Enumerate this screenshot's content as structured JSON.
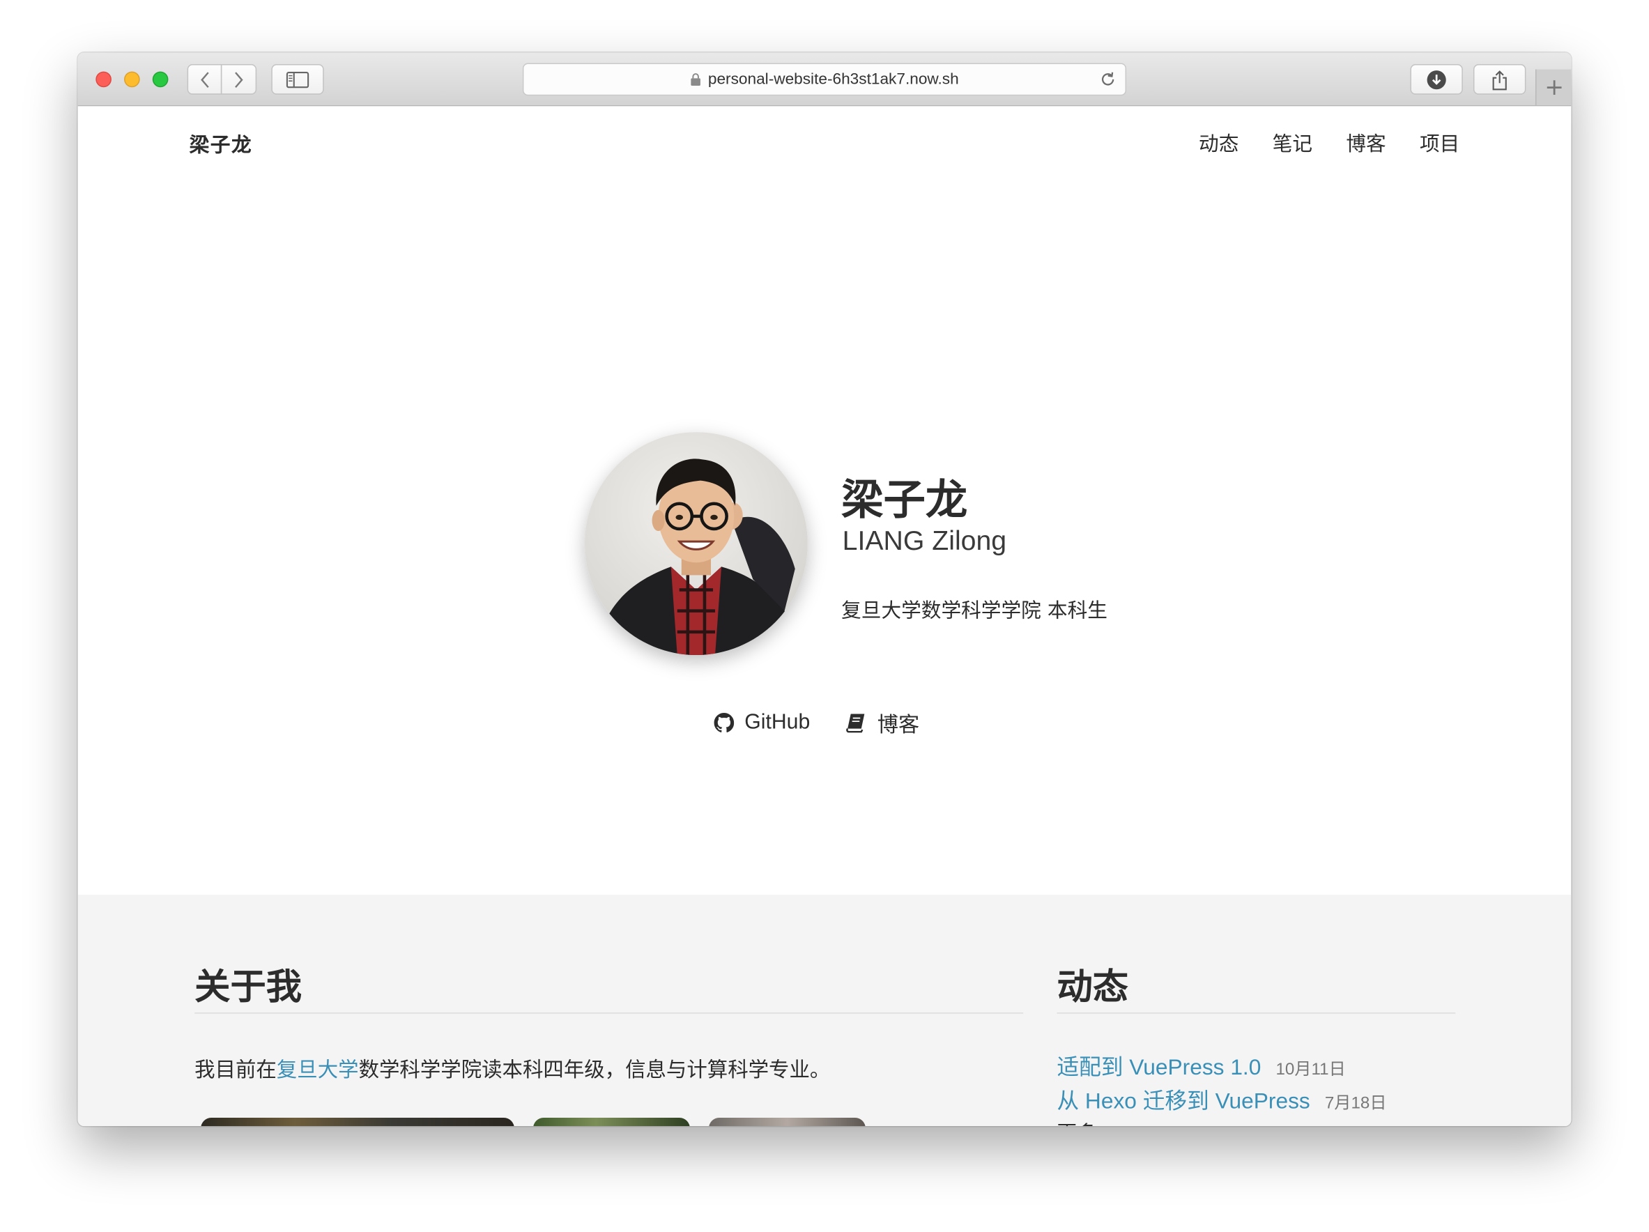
{
  "browser": {
    "url": "personal-website-6h3st1ak7.now.sh"
  },
  "site": {
    "title": "梁子龙",
    "nav": [
      "动态",
      "笔记",
      "博客",
      "项目"
    ]
  },
  "profile": {
    "name_zh": "梁子龙",
    "name_en": "LIANG Zilong",
    "affiliation": "复旦大学数学科学学院 本科生",
    "links": {
      "github": "GitHub",
      "blog": "博客"
    }
  },
  "about": {
    "heading": "关于我",
    "text_before": "我目前在",
    "link": "复旦大学",
    "text_after": "数学科学学院读本科四年级，信息与计算科学专业。"
  },
  "news": {
    "heading": "动态",
    "items": [
      {
        "title": "适配到 VuePress 1.0",
        "date": "10月11日"
      },
      {
        "title": "从 Hexo 迁移到 VuePress",
        "date": "7月18日"
      }
    ],
    "more": "更多"
  },
  "colors": {
    "link": "#3a8fb7",
    "text": "#2c2c2c",
    "section_bg": "#f4f4f4"
  }
}
